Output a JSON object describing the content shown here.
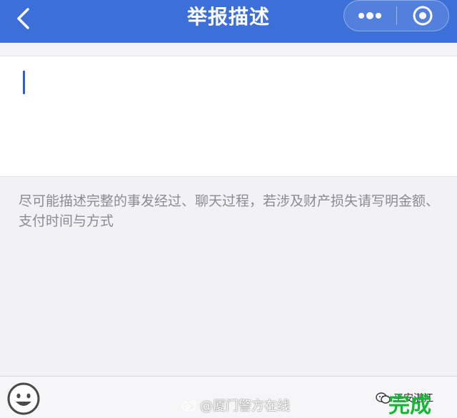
{
  "header": {
    "title": "举报描述",
    "icons": {
      "back": "chevron-left-icon",
      "more": "more-dots-icon",
      "close": "target-circle-icon"
    },
    "color": "#3d6fd9"
  },
  "editor": {
    "value": "",
    "hint": "尽可能描述完整的事发经过、聊天过程，若涉及财产损失请写明金额、支付时间与方式"
  },
  "bottom_bar": {
    "emoji_icon": "smiley-face-icon",
    "done_label": "完成",
    "done_color": "#13b935"
  },
  "watermarks": {
    "weibo": "@厦门警方在线",
    "corner": "平安湛江"
  }
}
